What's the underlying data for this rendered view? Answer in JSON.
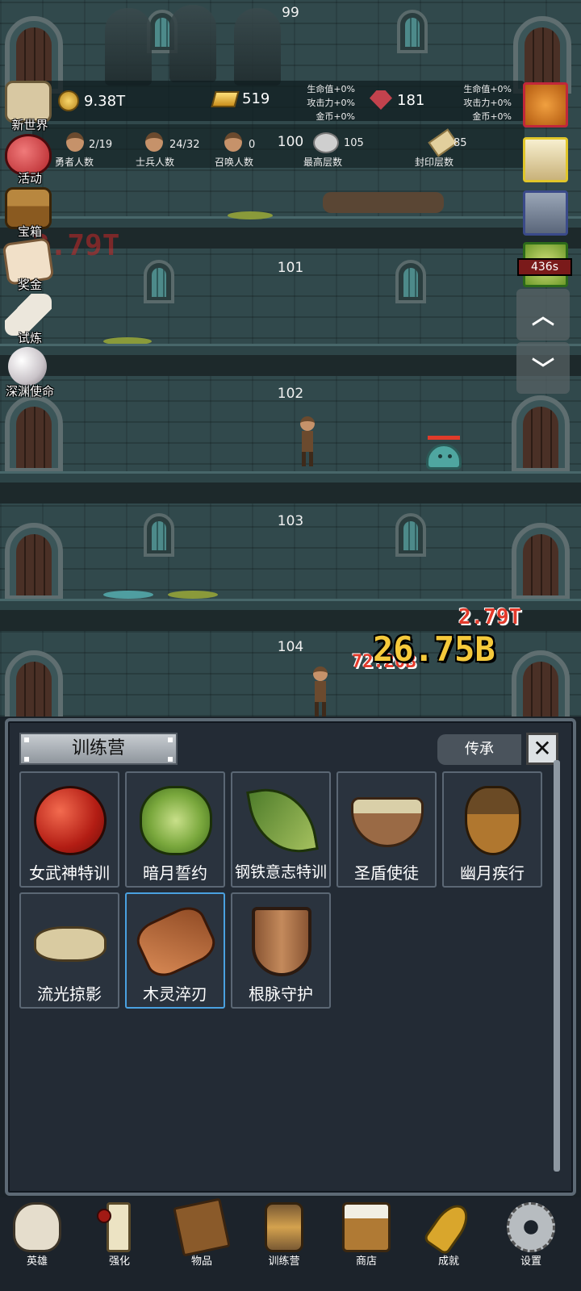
{
  "hud": {
    "gold": "9.38T",
    "bars": "519",
    "gems": "181",
    "bonus_left": [
      "生命值+0%",
      "攻击力+0%",
      "金币+0%"
    ],
    "bonus_right": [
      "生命值+0%",
      "攻击力+0%",
      "金币+0%"
    ],
    "stats": [
      {
        "value": "2/19",
        "label": "勇者人数"
      },
      {
        "value": "24/32",
        "label": "士兵人数"
      },
      {
        "value": "0",
        "label": "召唤人数"
      },
      {
        "value": "105",
        "label": "最高层数"
      },
      {
        "value": "85",
        "label": "封印层数"
      }
    ]
  },
  "floors": [
    "99",
    "100",
    "101",
    "102",
    "103",
    "104"
  ],
  "damage": {
    "ghost": "2.79T",
    "small_red": "2.79T",
    "big_gold": "26.75B",
    "red_behind": "72.20B"
  },
  "left_menu": [
    {
      "label": "新世界",
      "icon": "scroll-map-icon"
    },
    {
      "label": "活动",
      "icon": "heart-icon"
    },
    {
      "label": "宝箱",
      "icon": "chest-icon"
    },
    {
      "label": "奖金",
      "icon": "envelope-icon"
    },
    {
      "label": "试炼",
      "icon": "feather-icon"
    },
    {
      "label": "深渊使命",
      "icon": "pearl-icon"
    }
  ],
  "right_menu": {
    "timer": "436s"
  },
  "panel": {
    "title": "训练营",
    "inherit_label": "传承",
    "close_symbol": "✕",
    "items": [
      {
        "name": "女武神特训",
        "icon": "apple-icon"
      },
      {
        "name": "暗月誓约",
        "icon": "cabbage-icon"
      },
      {
        "name": "钢铁意志特训",
        "icon": "leaf-icon"
      },
      {
        "name": "圣盾使徒",
        "icon": "bowl-icon"
      },
      {
        "name": "幽月疾行",
        "icon": "acorn-icon"
      },
      {
        "name": "流光掠影",
        "icon": "bone-icon"
      },
      {
        "name": "木灵淬刃",
        "icon": "log-icon"
      },
      {
        "name": "根脉守护",
        "icon": "shield-icon"
      }
    ]
  },
  "bottom_nav": [
    {
      "label": "英雄",
      "icon": "skull-icon"
    },
    {
      "label": "强化",
      "icon": "candle-icon"
    },
    {
      "label": "物品",
      "icon": "book-icon"
    },
    {
      "label": "训练营",
      "icon": "lantern-icon"
    },
    {
      "label": "商店",
      "icon": "mug-icon"
    },
    {
      "label": "成就",
      "icon": "key-icon"
    },
    {
      "label": "设置",
      "icon": "gear-icon"
    }
  ],
  "colors": {
    "panel_bg": "#232b35",
    "selected_border": "#4aa1e0",
    "notice_dot": "#a11a14"
  }
}
